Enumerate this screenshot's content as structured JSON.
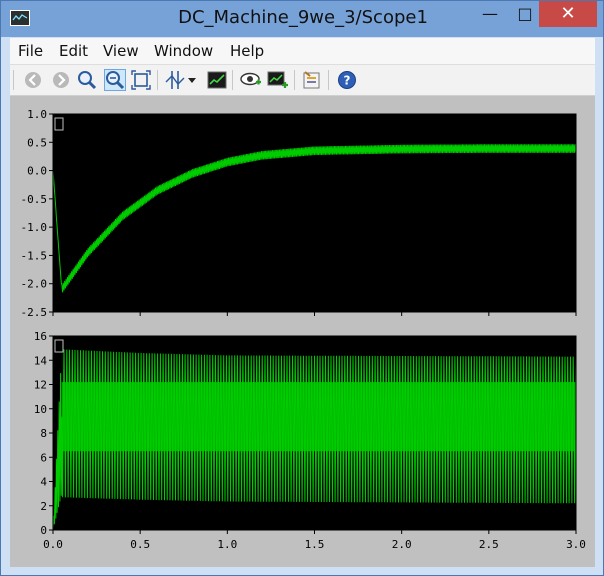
{
  "window": {
    "title": "DC_Machine_9we_3/Scope1",
    "minimize_glyph": "—",
    "maximize_glyph": "□",
    "close_glyph": "✕"
  },
  "menu": {
    "items": [
      "File",
      "Edit",
      "View",
      "Window",
      "Help"
    ]
  },
  "toolbar": {
    "icons": [
      "back-icon",
      "forward-icon",
      "zoom-in-icon",
      "zoom-x-icon",
      "zoom-y-icon",
      "cursor-measure-icon",
      "dropdown-icon",
      "autoscale-icon",
      "highlight-simulink-block-icon",
      "signal-selector-icon",
      "parameters-icon",
      "help-icon"
    ],
    "active": "zoom-x-icon"
  },
  "colors": {
    "plot_background": "#000000",
    "trace": "#00cc00",
    "frame": "#c0c0c0"
  },
  "chart_data": [
    {
      "type": "line",
      "ylim": [
        -2.5,
        1.0
      ],
      "xlim": [
        0.0,
        3.0
      ],
      "yticks": [
        "1.0",
        "0.5",
        "0.0",
        "-0.5",
        "-1.0",
        "-1.5",
        "-2.0",
        "-2.5"
      ],
      "series": [
        {
          "center": {
            "x": [
              0.0,
              0.05,
              0.2,
              0.4,
              0.6,
              0.8,
              1.0,
              1.2,
              1.5,
              2.0,
              2.5,
              3.0
            ],
            "y": [
              0.0,
              -2.1,
              -1.45,
              -0.8,
              -0.35,
              -0.05,
              0.15,
              0.27,
              0.35,
              0.38,
              0.39,
              0.39
            ]
          },
          "ripple": 0.15
        }
      ]
    },
    {
      "type": "line",
      "ylim": [
        0,
        16
      ],
      "xlim": [
        0.0,
        3.0
      ],
      "yticks": [
        "16",
        "14",
        "12",
        "10",
        "8",
        "6",
        "4",
        "2",
        "0"
      ],
      "xticks": [
        "0.0",
        "0.5",
        "1.0",
        "1.5",
        "2.0",
        "2.5",
        "3.0"
      ],
      "series": [
        {
          "envelope_top": {
            "x": [
              0.0,
              0.05,
              0.5,
              1.0,
              3.0
            ],
            "y": [
              0.0,
              14.9,
              14.6,
              14.4,
              14.3
            ]
          },
          "envelope_bottom": {
            "x": [
              0.0,
              0.05,
              0.5,
              1.0,
              3.0
            ],
            "y": [
              0.0,
              2.7,
              2.5,
              2.35,
              2.2
            ]
          },
          "dense_band": [
            6.5,
            12.2
          ]
        }
      ]
    }
  ]
}
